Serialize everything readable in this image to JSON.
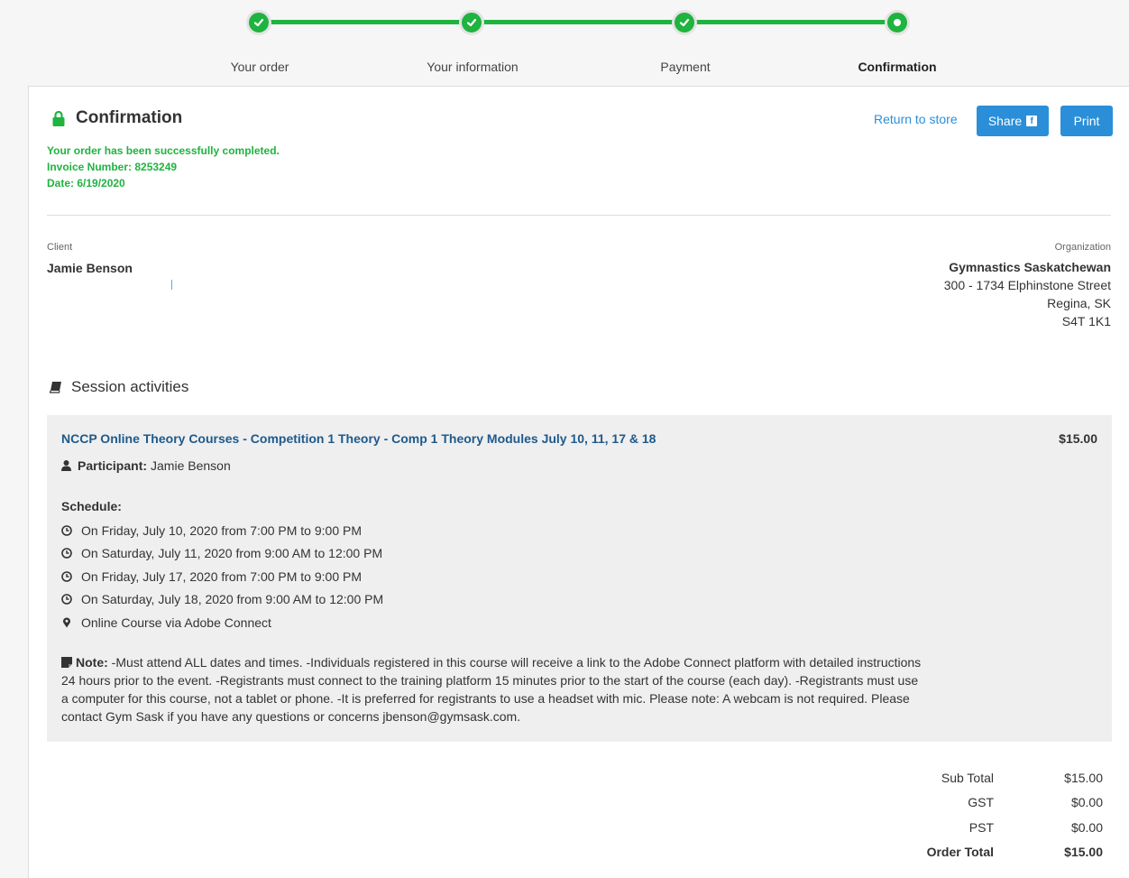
{
  "stepper": {
    "steps": [
      {
        "label": "Your order",
        "state": "done"
      },
      {
        "label": "Your information",
        "state": "done"
      },
      {
        "label": "Payment",
        "state": "done"
      },
      {
        "label": "Confirmation",
        "state": "current"
      }
    ]
  },
  "header": {
    "title": "Confirmation",
    "success_message": "Your order has been successfully completed.",
    "invoice": "Invoice Number: 8253249",
    "date": "Date: 6/19/2020",
    "return_label": "Return to store",
    "share_label": "Share",
    "share_icon_glyph": "f",
    "print_label": "Print"
  },
  "client": {
    "label": "Client",
    "name": "Jamie Benson"
  },
  "organization": {
    "label": "Organization",
    "name": "Gymnastics Saskatchewan",
    "address1": "300 - 1734 Elphinstone Street",
    "city": "Regina, SK",
    "postal": "S4T 1K1"
  },
  "session": {
    "heading": "Session activities",
    "activity": {
      "title": "NCCP Online Theory Courses - Competition 1 Theory - Comp 1 Theory Modules July 10, 11, 17 & 18",
      "price": "$15.00",
      "participant_label": "Participant:",
      "participant_name": "Jamie Benson",
      "schedule_label": "Schedule:",
      "schedule": [
        "On Friday, July 10, 2020 from 7:00 PM to 9:00 PM",
        "On Saturday, July 11, 2020 from 9:00 AM to 12:00 PM",
        "On Friday, July 17, 2020 from 7:00 PM to 9:00 PM",
        "On Saturday, July 18, 2020 from 9:00 AM to 12:00 PM"
      ],
      "location": "Online Course via Adobe Connect",
      "note_label": "Note:",
      "note_text": "-Must attend ALL dates and times. -Individuals registered in this course will receive a link to the Adobe Connect platform with detailed instructions 24 hours prior to the event. -Registrants must connect to the training platform 15 minutes prior to the start of the course (each day). -Registrants must use a computer for this course, not a tablet or phone. -It is preferred for registrants to use a headset with mic. Please note: A webcam is not required. Please contact Gym Sask if you have any questions or concerns jbenson@gymsask.com."
    }
  },
  "totals": {
    "subtotal_label": "Sub Total",
    "subtotal": "$15.00",
    "gst_label": "GST",
    "gst": "$0.00",
    "pst_label": "PST",
    "pst": "$0.00",
    "order_total_label": "Order Total",
    "order_total": "$15.00"
  },
  "colors": {
    "accent_green": "#1fb33f",
    "button_blue": "#2a8fd8",
    "title_blue": "#1e5a8c"
  }
}
